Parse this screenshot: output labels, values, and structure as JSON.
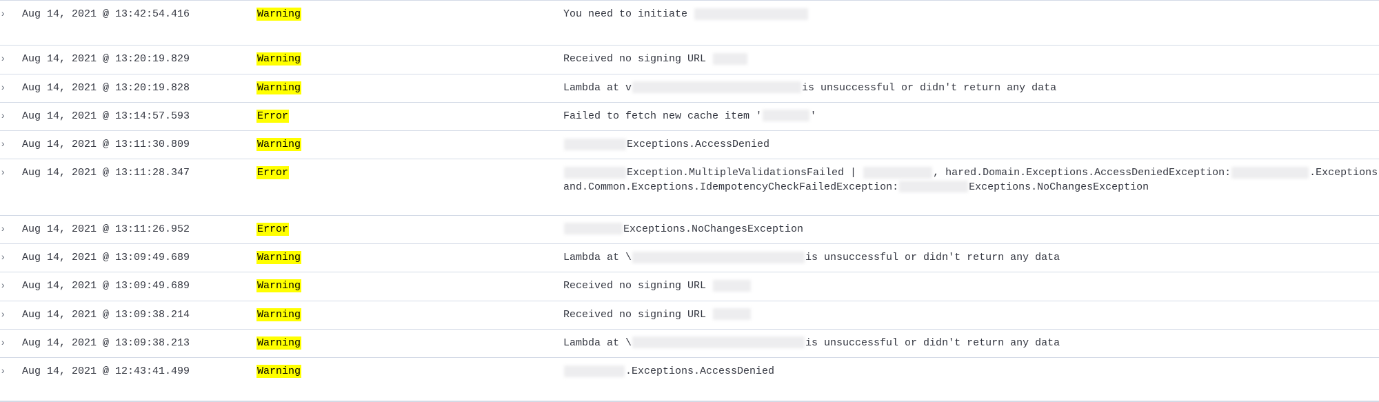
{
  "table": {
    "caret_glyph": "›",
    "zoom_icon_name": "magnify-icon",
    "rows": [
      {
        "time": "Aug 14, 2021 @ 13:42:54.416",
        "level": "Warning",
        "message": "You need to initiate",
        "message2": ""
      },
      {
        "time": "Aug 14, 2021 @ 13:20:19.829",
        "level": "Warning",
        "message": "Received no signing URL",
        "message2": ""
      },
      {
        "time": "Aug 14, 2021 @ 13:20:19.828",
        "level": "Warning",
        "message": "Lambda at v",
        "message_tail": "is unsuccessful or didn't return any data",
        "message2": ""
      },
      {
        "time": "Aug 14, 2021 @ 13:14:57.593",
        "level": "Error",
        "message": "Failed to fetch new cache item '",
        "message_tail": "'",
        "message2": ""
      },
      {
        "time": "Aug 14, 2021 @ 13:11:30.809",
        "level": "Warning",
        "message": "Exceptions.AccessDenied",
        "message2": ""
      },
      {
        "time": "Aug 14, 2021 @ 13:11:28.347",
        "level": "Error",
        "message": "Exception.MultipleValidationsFailed | ",
        "message_mid": ", hared.Domain.Exceptions.AccessDeniedException:",
        "message_mid2": ".Exceptions.AccessDenied,(",
        "message_tail": "'.(",
        "message2": "and.Common.Exceptions.IdempotencyCheckFailedException:",
        "message2_tail": "Exceptions.NoChangesException"
      },
      {
        "time": "Aug 14, 2021 @ 13:11:26.952",
        "level": "Error",
        "message": "Exceptions.NoChangesException",
        "message2": ""
      },
      {
        "time": "Aug 14, 2021 @ 13:09:49.689",
        "level": "Warning",
        "message": "Lambda at \\",
        "message_tail": "is unsuccessful or didn't return any data",
        "message2": ""
      },
      {
        "time": "Aug 14, 2021 @ 13:09:49.689",
        "level": "Warning",
        "message": "Received no signing URL",
        "message2": ""
      },
      {
        "time": "Aug 14, 2021 @ 13:09:38.214",
        "level": "Warning",
        "message": "Received no signing URL",
        "message2": ""
      },
      {
        "time": "Aug 14, 2021 @ 13:09:38.213",
        "level": "Warning",
        "message": "Lambda at \\",
        "message_tail": "is unsuccessful or didn't return any data",
        "message2": ""
      },
      {
        "time": "Aug 14, 2021 @ 12:43:41.499",
        "level": "Warning",
        "message": ".Exceptions.AccessDenied",
        "message2": ""
      }
    ]
  },
  "colors": {
    "highlight": "#ffff00",
    "row_border": "#d3dae6",
    "text": "#343741",
    "redaction_yellow": "#eeeb8d",
    "redaction_gray": "#ededef"
  }
}
